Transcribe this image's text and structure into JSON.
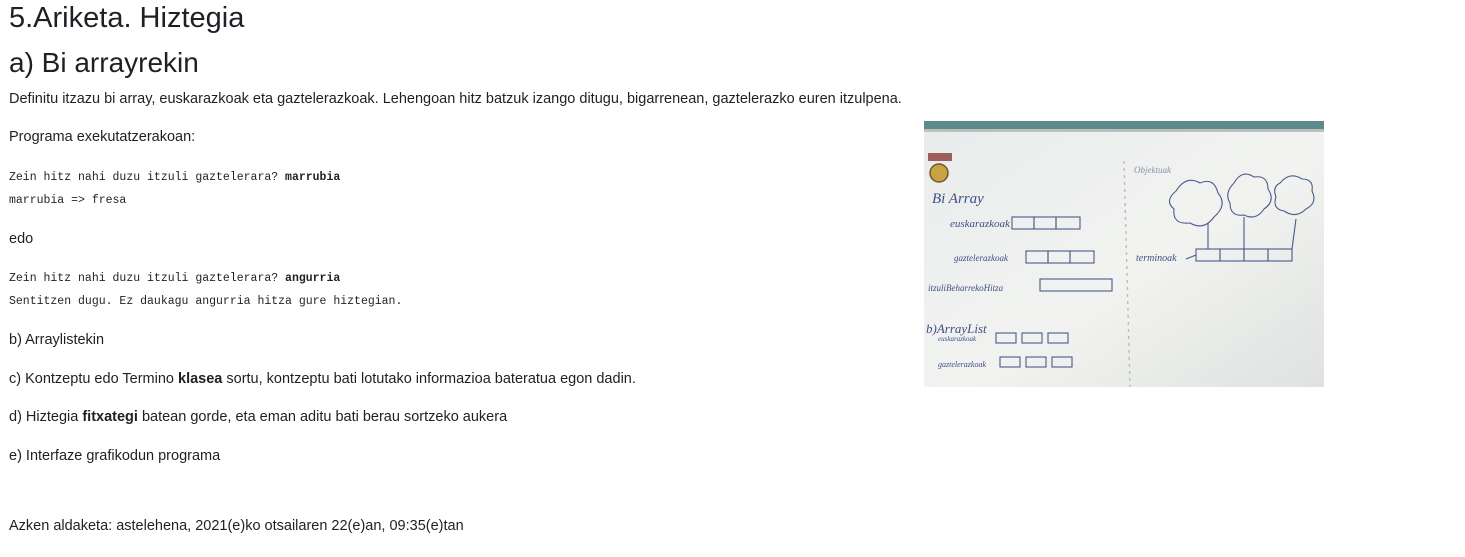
{
  "page": {
    "title": "5.Ariketa. Hiztegia",
    "subtitle": "a) Bi arrayrekin",
    "intro": "Definitu itzazu bi array, euskarazkoak eta gaztelerazkoak. Lehengoan hitz batzuk izango ditugu, bigarrenean, gaztelerazko euren itzulpena.",
    "execution_label": "Programa exekutatzerakoan:",
    "example1": {
      "prompt": "Zein hitz nahi duzu itzuli gaztelerara? ",
      "input": "marrubia",
      "output": "marrubia => fresa"
    },
    "or_label": "edo",
    "example2": {
      "prompt": "Zein hitz nahi duzu itzuli gaztelerara? ",
      "input": "angurria",
      "output": "Sentitzen dugu. Ez daukagu angurria hitza gure hiztegian."
    },
    "item_b": "b) Arraylistekin",
    "item_c": {
      "before": "c) Kontzeptu edo Termino ",
      "bold": "klasea",
      "after": " sortu, kontzeptu bati lotutako informazioa bateratua egon dadin."
    },
    "item_d": {
      "before": "d) Hiztegia ",
      "bold": "fitxategi",
      "after": " batean gorde, eta eman aditu bati berau sortzeko aukera"
    },
    "item_e": "e) Interfaze grafikodun programa",
    "last_modified": "Azken aldaketa: astelehena, 2021(e)ko otsailaren 22(e)an, 09:35(e)tan"
  },
  "whiteboard": {
    "heading_a": "Bi Array",
    "row1": "euskarazkoak",
    "row2": "gaztelerazkoak",
    "row3": "itzuliBeharrekoHitza",
    "heading_b": "b)ArrayList",
    "row4": "euskarazkoak",
    "row5": "gaztelerazkoak",
    "right_label": "terminoak",
    "top_right": "Objektuak"
  }
}
